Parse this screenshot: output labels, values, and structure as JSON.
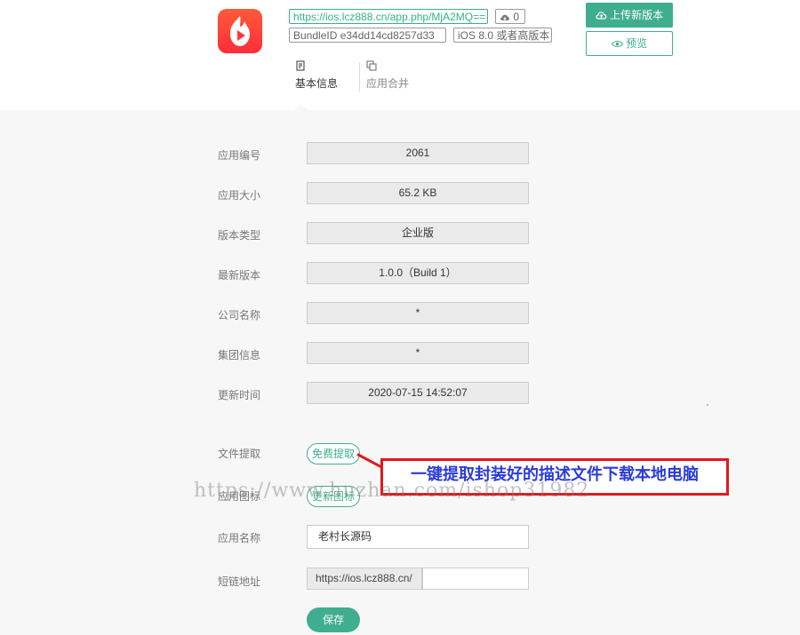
{
  "header": {
    "app_url": "https://ios.lcz888.cn/app.php/MjA2MQ==",
    "download_count": "0",
    "bundle_id": "BundleID   e34dd14cd8257d33",
    "min_os": "iOS 8.0 或者高版本",
    "upload_label": "上传新版本",
    "preview_label": "预览"
  },
  "tabs": [
    {
      "label": "基本信息",
      "active": true
    },
    {
      "label": "应用合并",
      "active": false
    }
  ],
  "fields": {
    "app_id_label": "应用编号",
    "app_id": "2061",
    "size_label": "应用大小",
    "size": "65.2 KB",
    "type_label": "版本类型",
    "type": "企业版",
    "version_label": "最新版本",
    "version": "1.0.0（Build 1）",
    "company_label": "公司名称",
    "company": "*",
    "group_label": "集团信息",
    "group": "*",
    "updated_label": "更新时间",
    "updated": "2020-07-15 14:52:07",
    "file_label": "文件提取",
    "file_button": "免费提取",
    "icon_label": "应用图标",
    "icon_button": "更新图标",
    "name_label": "应用名称",
    "name": "老村长源码",
    "short_label": "短链地址",
    "short_prefix": "https://ios.lcz888.cn/",
    "short_value": ""
  },
  "save_label": "保存",
  "annotation": "一键提取封装好的描述文件下载本地电脑",
  "watermark": "https://www.huzhan.com/ishop31982",
  "colors": {
    "accent": "#3fae8f",
    "annotation_border": "#e0191e",
    "annotation_text": "#2b3bd6"
  }
}
